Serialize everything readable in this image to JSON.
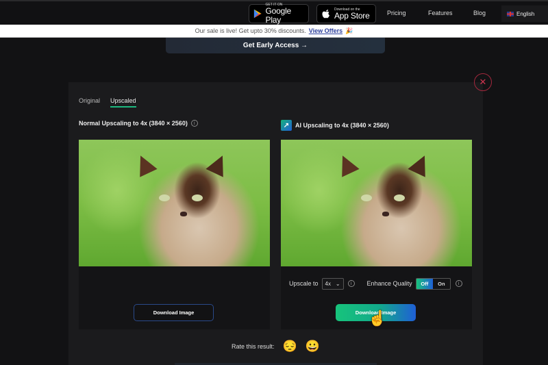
{
  "nav": {
    "google_play": {
      "small": "GET IT ON",
      "big": "Google Play"
    },
    "app_store": {
      "small": "Download on the",
      "big": "App Store"
    },
    "links": [
      "Pricing",
      "Features",
      "Blog"
    ],
    "language": "English"
  },
  "sale_bar": {
    "text": "Our sale is live! Get upto 30% discounts.",
    "link": "View Offers",
    "emoji": "🎉"
  },
  "early_access": "Get Early Access →",
  "modal": {
    "tabs": [
      {
        "label": "Original",
        "active": false
      },
      {
        "label": "Upscaled",
        "active": true
      }
    ],
    "left_panel": {
      "title": "Normal Upscaling to 4x (3840 × 2560)",
      "download_label": "Download Image"
    },
    "right_panel": {
      "title": "AI Upscaling to 4x (3840 × 2560)",
      "upscale_label": "Upscale to",
      "upscale_value": "4x",
      "enhance_label": "Enhance Quality",
      "toggle_off": "Off",
      "toggle_on": "On",
      "download_label": "Download Image"
    },
    "rate": {
      "label": "Rate this result:",
      "emojis": [
        "😔",
        "😀"
      ]
    }
  },
  "colors": {
    "accent_green": "#17c47b",
    "accent_blue": "#1f5fd6",
    "close_red": "#d0354f",
    "tab_underline": "#1db980"
  }
}
